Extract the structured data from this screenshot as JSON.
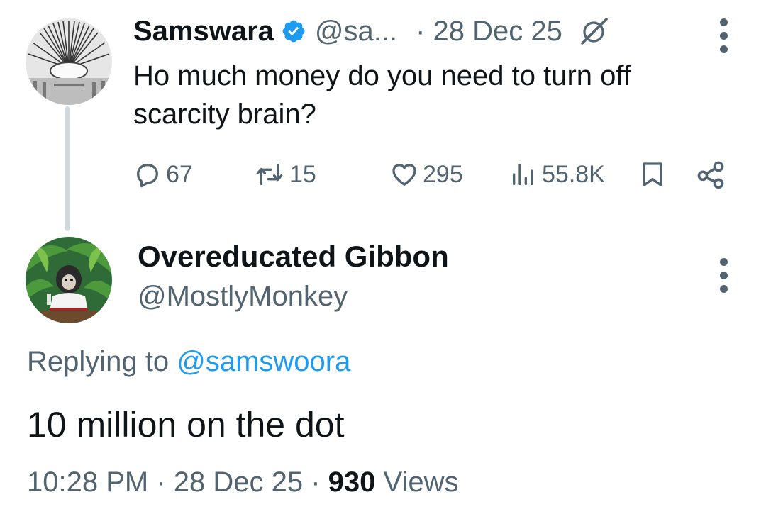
{
  "original_tweet": {
    "author_name": "Samswara",
    "author_handle": "@sa...",
    "date": "· 28 Dec 25",
    "text": "Ho much money do you need to turn off scarcity brain?",
    "icons": [
      "verified-badge-icon",
      "grok-icon",
      "more-options-icon"
    ],
    "actions": {
      "replies": "67",
      "retweets": "15",
      "likes": "295",
      "views": "55.8K"
    }
  },
  "reply_tweet": {
    "author_name": "Overeducated Gibbon",
    "author_handle": "@MostlyMonkey",
    "replying_prefix": "Replying to ",
    "replying_to": "@samswoora",
    "text": "10 million on the dot",
    "timestamp": "10:28 PM · 28 Dec 25 · ",
    "views_count": "930",
    "views_label": " Views"
  },
  "colors": {
    "verified": "#1d9bf0",
    "link": "#1d9bf0",
    "secondary_text": "#536471",
    "primary_text": "#0f1419",
    "thread_line": "#cfd9de"
  }
}
